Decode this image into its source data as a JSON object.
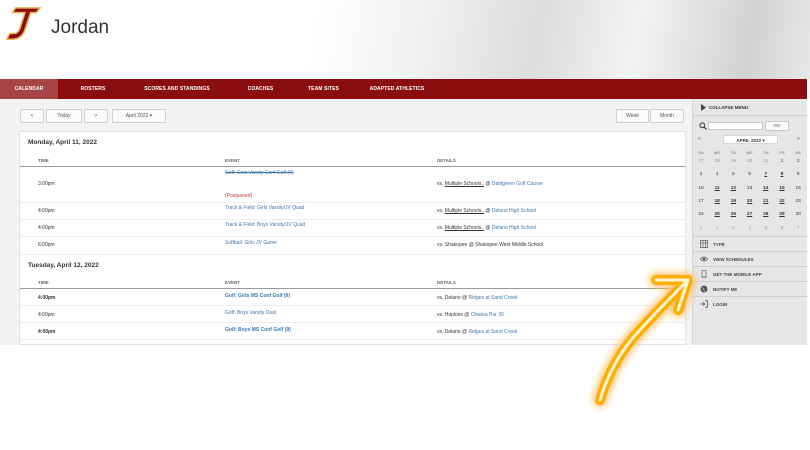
{
  "header": {
    "school_name": "Jordan",
    "logo_letter": "J"
  },
  "nav": [
    {
      "label": "CALENDAR",
      "active": true
    },
    {
      "label": "ROSTERS"
    },
    {
      "label": "SCORES AND STANDINGS"
    },
    {
      "label": "COACHES"
    },
    {
      "label": "TEAM SITES"
    },
    {
      "label": "ADAPTED ATHLETICS"
    }
  ],
  "toolbar": {
    "prev": "<",
    "today": "Today",
    "next": ">",
    "month_select": "April 2022 ▾",
    "week": "Week",
    "month": "Month"
  },
  "columns": {
    "time": "TIME",
    "event": "EVENT",
    "details": "DETAILS"
  },
  "days": [
    {
      "heading": "Monday, April 11, 2022",
      "rows": [
        {
          "time": "3:00pm",
          "event": "Golf: Girls Varsity Conf Golf (9)",
          "strike": true,
          "status": "(Postponed)",
          "details_pre": "vs.",
          "opponent": "Multiple Schools..",
          "at": "@",
          "location": "Dahlgreen Golf Course"
        },
        {
          "time": "4:00pm",
          "event": "Track & Field: Girls Varsity/JV Quad",
          "details_pre": "vs.",
          "opponent": "Multiple Schools..",
          "at": "@",
          "location": "Delano High School"
        },
        {
          "time": "4:00pm",
          "event": "Track & Field: Boys Varsity/JV Quad",
          "details_pre": "vs.",
          "opponent": "Multiple Schools..",
          "at": "@",
          "location": "Delano High School"
        },
        {
          "time": "6:00pm",
          "event": "Softball: Girls JV Game",
          "details_pre": "vs.",
          "opponent": "Shakopee",
          "at": "@",
          "location": "Shakopee West Middle School"
        }
      ]
    },
    {
      "heading": "Tuesday, April 12, 2022",
      "rows": [
        {
          "time": "4:00pm",
          "bold": true,
          "event": "Golf: Girls MS Conf Golf (9)",
          "details_pre": "vs.",
          "opponent": "Delano",
          "at": "@",
          "location": "Ridges at Sand Creek"
        },
        {
          "time": "4:00pm",
          "event": "Golf: Boys Varsity Dual",
          "details_pre": "vs.",
          "opponent": "Hopkins",
          "at": "@",
          "location": "Chaska Par 30"
        },
        {
          "time": "4:00pm",
          "bold": true,
          "event": "Golf: Boys MS Conf Golf (9)",
          "details_pre": "vs.",
          "opponent": "Delano",
          "at": "@",
          "location": "Ridges at Sand Creek"
        }
      ]
    }
  ],
  "sidebar": {
    "collapse_label": "COLLAPSE MENU",
    "go_label": "GO",
    "mini_cal": {
      "prev": "«",
      "next": "»",
      "month_label": "APRIL 2022 ▾",
      "dow": [
        "SU",
        "MO",
        "TU",
        "WE",
        "TH",
        "FR",
        "SA"
      ],
      "weeks": [
        [
          "27",
          "28",
          "29",
          "30",
          "31",
          "1",
          "2"
        ],
        [
          "3",
          "4",
          "5",
          "6",
          "7",
          "8",
          "9"
        ],
        [
          "10",
          "11",
          "12",
          "13",
          "14",
          "15",
          "16"
        ],
        [
          "17",
          "18",
          "19",
          "20",
          "21",
          "22",
          "23"
        ],
        [
          "24",
          "25",
          "26",
          "27",
          "28",
          "29",
          "30"
        ],
        [
          "1",
          "2",
          "3",
          "4",
          "5",
          "6",
          "7"
        ]
      ]
    },
    "items": [
      {
        "label": "TYPE",
        "icon": "grid-icon"
      },
      {
        "label": "VIEW SCHEDULES",
        "icon": "eye-icon"
      },
      {
        "label": "GET THE MOBILE APP",
        "icon": "mobile-icon"
      },
      {
        "label": "NOTIFY ME",
        "icon": "globe-icon"
      },
      {
        "label": "LOGIN",
        "icon": "login-icon"
      }
    ]
  },
  "colors": {
    "brand": "#8b0e0f",
    "link": "#3f76ad",
    "postponed": "#d0352f",
    "arrow_glow": "#ffb300"
  }
}
